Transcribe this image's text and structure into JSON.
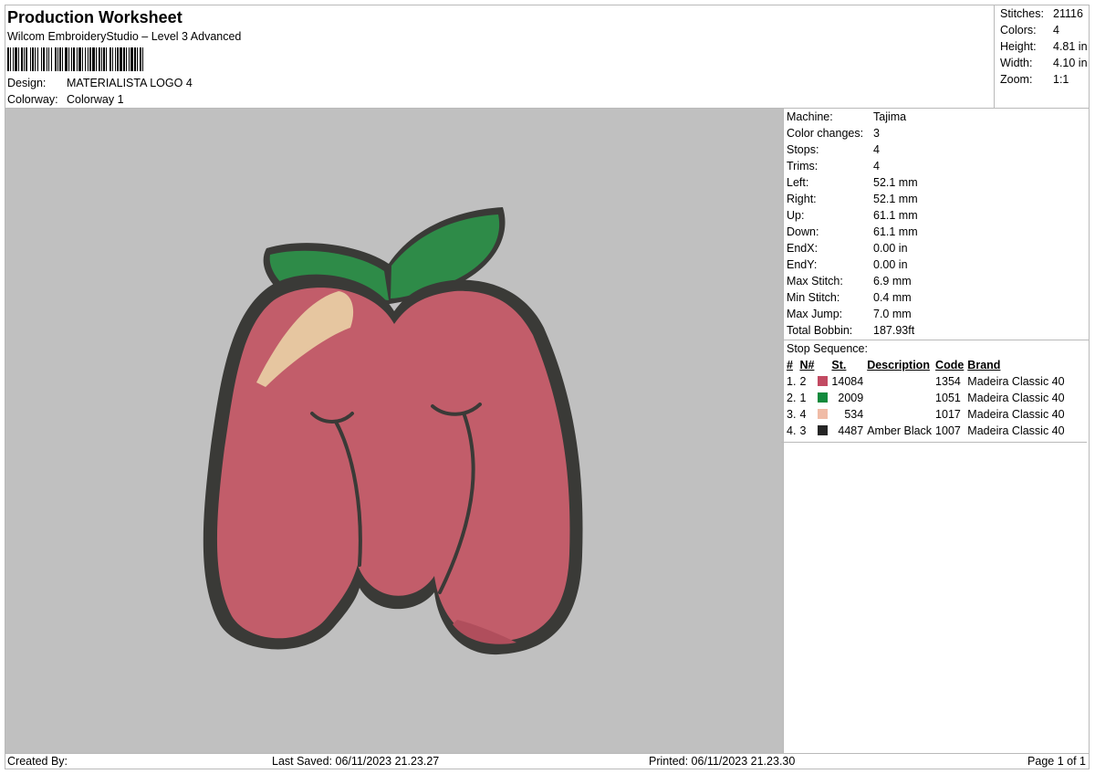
{
  "header": {
    "title": "Production Worksheet",
    "software": "Wilcom EmbroideryStudio – Level 3 Advanced",
    "design_label": "Design:",
    "design_value": "MATERIALISTA LOGO 4",
    "colorway_label": "Colorway:",
    "colorway_value": "Colorway 1"
  },
  "summary": {
    "stitches_label": "Stitches:",
    "stitches_value": "21116",
    "colors_label": "Colors:",
    "colors_value": "4",
    "height_label": "Height:",
    "height_value": "4.81 in",
    "width_label": "Width:",
    "width_value": "4.10 in",
    "zoom_label": "Zoom:",
    "zoom_value": "1:1"
  },
  "machine": [
    {
      "label": "Machine:",
      "value": "Tajima"
    },
    {
      "label": "Color changes:",
      "value": "3"
    },
    {
      "label": "Stops:",
      "value": "4"
    },
    {
      "label": "Trims:",
      "value": "4"
    },
    {
      "label": "Left:",
      "value": "52.1 mm"
    },
    {
      "label": "Right:",
      "value": "52.1 mm"
    },
    {
      "label": "Up:",
      "value": "61.1 mm"
    },
    {
      "label": "Down:",
      "value": "61.1 mm"
    },
    {
      "label": "EndX:",
      "value": "0.00 in"
    },
    {
      "label": "EndY:",
      "value": "0.00 in"
    },
    {
      "label": "Max Stitch:",
      "value": "6.9 mm"
    },
    {
      "label": "Min Stitch:",
      "value": "0.4 mm"
    },
    {
      "label": "Max Jump:",
      "value": "7.0 mm"
    },
    {
      "label": "Total Bobbin:",
      "value": "187.93ft"
    }
  ],
  "stop_sequence": {
    "heading": "Stop Sequence:",
    "columns": [
      "#",
      "N#",
      "St.",
      "Description",
      "Code",
      "Brand"
    ],
    "rows": [
      {
        "idx": "1.",
        "n": "2",
        "color": "#c24a62",
        "st": "14084",
        "desc": "",
        "code": "1354",
        "brand": "Madeira Classic 40"
      },
      {
        "idx": "2.",
        "n": "1",
        "color": "#118a3c",
        "st": "2009",
        "desc": "",
        "code": "1051",
        "brand": "Madeira Classic 40"
      },
      {
        "idx": "3.",
        "n": "4",
        "color": "#f0bba6",
        "st": "534",
        "desc": "",
        "code": "1017",
        "brand": "Madeira Classic 40"
      },
      {
        "idx": "4.",
        "n": "3",
        "color": "#252525",
        "st": "4487",
        "desc": "Amber Black",
        "code": "1007",
        "brand": "Madeira Classic 40"
      }
    ]
  },
  "footer": {
    "created_by": "Created By:",
    "last_saved": "Last Saved: 06/11/2023 21.23.27",
    "printed": "Printed: 06/11/2023 21.23.30",
    "page": "Page 1 of 1"
  },
  "design_colors": {
    "background": "#c0c0c0",
    "outline": "#3a3a37",
    "body": "#c25d6a",
    "leaf": "#2e8b48",
    "highlight": "#e6c6a0"
  }
}
